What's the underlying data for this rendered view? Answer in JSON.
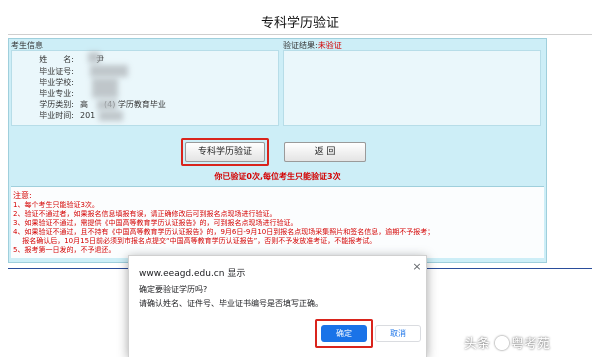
{
  "page": {
    "title": "专科学历验证"
  },
  "candidate_section": {
    "heading": "考生信息",
    "rows": [
      {
        "label": "姓　　名:",
        "value": "尹"
      },
      {
        "label": "毕业证号:",
        "value": ""
      },
      {
        "label": "毕业学校:",
        "value": ""
      },
      {
        "label": "毕业专业:",
        "value": ""
      },
      {
        "label": "学历类别:",
        "value": "高　　(4) 学历教育毕业"
      },
      {
        "label": "毕业时间:",
        "value": "201"
      }
    ]
  },
  "verify_section": {
    "heading": "验证结果:",
    "status": "未验证"
  },
  "buttons": {
    "verify_label": "专科学历验证",
    "back_label": "返 回"
  },
  "attempt_note": "你已验证0次,每位考生只能验证3次",
  "notes": {
    "title": "注意:",
    "lines": [
      "1、每个考生只能验证3次。",
      "2、验证不通过者，如果报名信息填报有误，请正确修改后可到报名点现场进行验证。",
      "3、如果验证不通过，需提供《中国高等教育学历认证报告》的，可到报名点现场进行验证。",
      "4、如果验证不通过，且不持有《中国高等教育学历认证报告》的，9月6日-9月10日到报名点现场采集照片和签名信息，逾期不予报考；",
      "　 报名确认后，10月15日前必须到市报名点提交“中国高等教育学历认证报告”，否则不予发放准考证，不能报考试。",
      "5、报考第一日发的，不予退还。"
    ]
  },
  "dialog": {
    "site": "www.eeagd.edu.cn 显示",
    "question": "确定要验证学历吗?",
    "message": "请确认姓名、证件号、毕业证书编号是否填写正确。",
    "ok_label": "确定",
    "cancel_label": "取消",
    "close_icon": "close-icon"
  },
  "watermark": {
    "prefix": "头条",
    "handle": "粤考苑"
  },
  "colors": {
    "form_bg": "#cdeef7",
    "alert_red": "#d40000",
    "highlight_frame": "#d9241c",
    "dialog_primary": "#1a73e8"
  }
}
